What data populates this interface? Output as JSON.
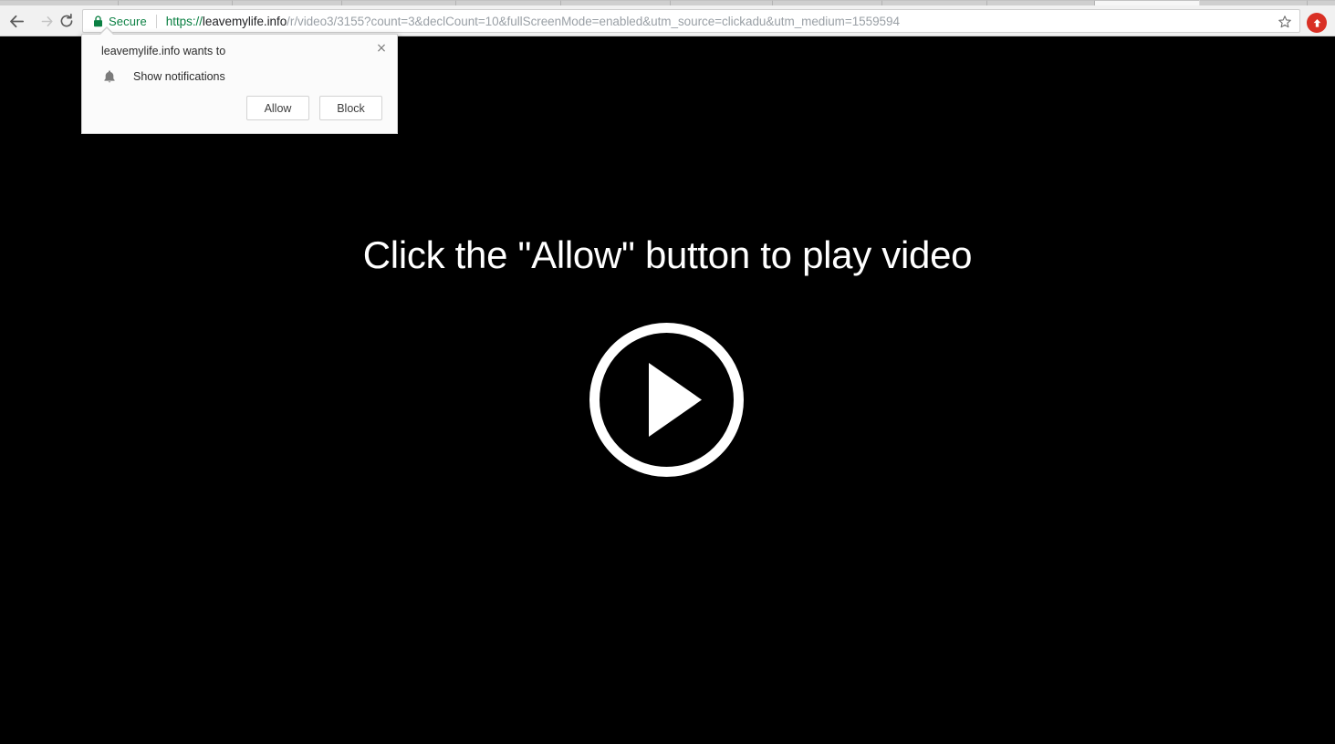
{
  "browser": {
    "back_icon": "arrow-left-icon",
    "forward_icon": "arrow-right-icon",
    "reload_icon": "reload-icon",
    "omnibox": {
      "lock_icon": "lock-icon",
      "security_label": "Secure",
      "security_color": "#0b8043",
      "url_scheme": "https://",
      "url_host": "leavemylife.info",
      "url_path": "/r/video3/3155?count=3&declCount=10&fullScreenMode=enabled&utm_source=clickadu&utm_medium=1559594",
      "url_full": "https://leavemylife.info/r/video3/3155?count=3&declCount=10&fullScreenMode=enabled&utm_source=clickadu&utm_medium=1559594",
      "star_icon": "star-outline-icon"
    },
    "extension_badge": {
      "icon": "up-arrow-circle-icon",
      "color": "#d93025"
    },
    "toolbar_bg": "#f1f1f1",
    "tabstrip_bg": "#d4d4d4"
  },
  "permission_prompt": {
    "title": "leavemylife.info wants to",
    "request_icon": "bell-icon",
    "request_label": "Show notifications",
    "allow_label": "Allow",
    "block_label": "Block",
    "close_icon": "close-icon",
    "close_glyph": "×"
  },
  "page": {
    "background": "#000000",
    "heading": "Click the \"Allow\" button to play video",
    "heading_color": "#ffffff",
    "play_button_icon": "play-circle-icon",
    "play_button_color": "#ffffff"
  }
}
